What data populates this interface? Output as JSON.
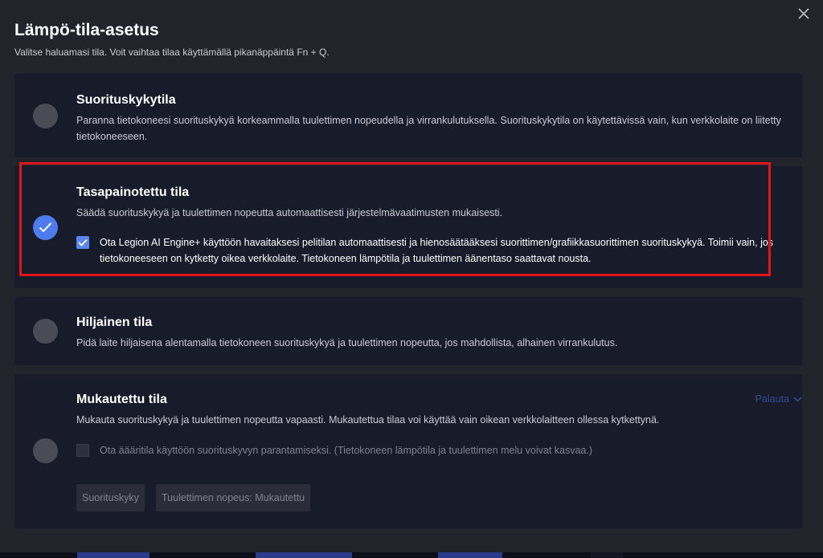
{
  "dialog": {
    "title": "Lämpö-tila-asetus",
    "subtitle": "Valitse haluamasi tila. Voit vaihtaa tilaa käyttämällä pikanäppäintä Fn + Q.",
    "close_icon": "close-icon"
  },
  "modes": {
    "performance": {
      "title": "Suorituskykytila",
      "description": "Paranna tietokoneesi suorituskykyä korkeammalla tuulettimen nopeudella ja virrankulutuksella. Suorituskykytila on käytettävissä vain, kun verkkolaite on liitetty tietokoneeseen.",
      "selected": false
    },
    "balanced": {
      "title": "Tasapainotettu tila",
      "description": "Säädä suorituskykyä ja tuulettimen nopeutta automaattisesti järjestelmävaatimusten mukaisesti.",
      "selected": true,
      "ai_engine": {
        "checked": true,
        "label": "Ota Legion AI Engine+ käyttöön havaitaksesi pelitilan automaattisesti ja hienosäätääksesi suorittimen/grafiikkasuorittimen suorituskykyä. Toimii vain, jos tietokoneeseen on kytketty oikea verkkolaite. Tietokoneen lämpötila ja tuulettimen äänentaso saattavat nousta."
      }
    },
    "quiet": {
      "title": "Hiljainen tila",
      "description": "Pidä laite hiljaisena alentamalla tietokoneen suorituskykyä ja tuulettimen nopeutta, jos mahdollista, alhainen virrankulutus.",
      "selected": false
    },
    "custom": {
      "title": "Mukautettu tila",
      "description": "Mukauta suorituskykyä ja tuulettimen nopeutta vapaasti. Mukautettua tilaa voi käyttää vain oikean verkkolaitteen ollessa kytkettynä.",
      "selected": false,
      "reset_label": "Palauta",
      "extreme": {
        "checked": false,
        "label": "Ota äääritila käyttöön suorituskyvyn parantamiseksi. (Tietokoneen lämpötila ja tuulettimen melu voivat kasvaa.)"
      },
      "buttons": {
        "performance": "Suorituskyky",
        "fan_speed": "Tuulettimen nopeus: Mukautettu"
      }
    }
  },
  "colors": {
    "background": "#22242b",
    "card": "#181b29",
    "accent": "#4f7bf0",
    "highlight_border": "#e0161c"
  }
}
